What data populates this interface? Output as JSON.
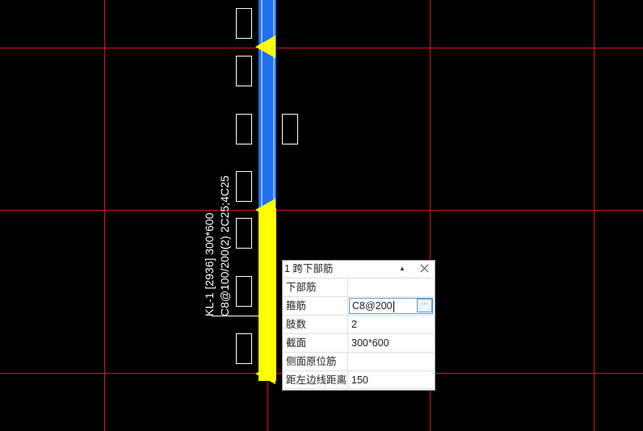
{
  "beam_label": {
    "line1": "KL-1 [2936] 300*600",
    "line2": "C8@100/200(2) 2C25;4C25"
  },
  "colors": {
    "background": "#000000",
    "axis_grid": "#e0101a",
    "beam_blue": "#1f6ef0",
    "beam_selected": "#ffff00",
    "column_outline": "#ffffff"
  },
  "property_panel": {
    "title": "1 跨下部筋",
    "pin_icon": "pin-icon",
    "close_icon": "close-icon",
    "rows": [
      {
        "key": "下部筋",
        "value": ""
      },
      {
        "key": "箍筋",
        "value": "C8@200"
      },
      {
        "key": "肢数",
        "value": "2"
      },
      {
        "key": "截面",
        "value": "300*600"
      },
      {
        "key": "侧面原位筋",
        "value": ""
      },
      {
        "key": "距左边线距离",
        "value": "150"
      }
    ],
    "ellipsis_label": "···"
  }
}
